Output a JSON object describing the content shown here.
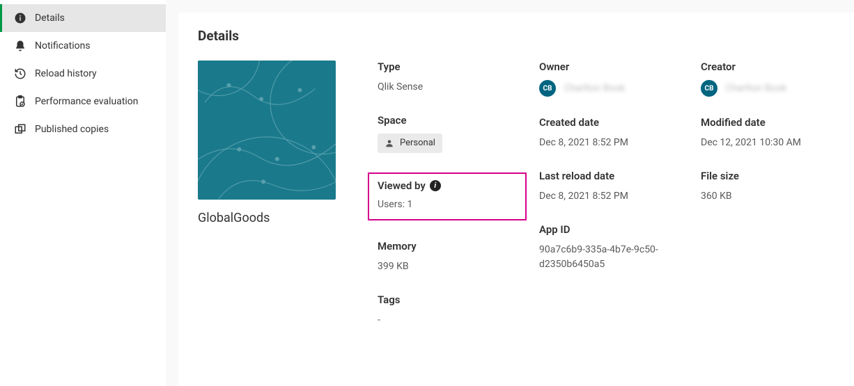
{
  "sidebar": {
    "items": [
      {
        "label": "Details"
      },
      {
        "label": "Notifications"
      },
      {
        "label": "Reload history"
      },
      {
        "label": "Performance evaluation"
      },
      {
        "label": "Published copies"
      }
    ]
  },
  "page": {
    "title": "Details"
  },
  "app": {
    "name": "GlobalGoods"
  },
  "details": {
    "type": {
      "label": "Type",
      "value": "Qlik Sense"
    },
    "space": {
      "label": "Space",
      "value": "Personal"
    },
    "viewed_by": {
      "label": "Viewed by",
      "value": "Users: 1"
    },
    "memory": {
      "label": "Memory",
      "value": "399 KB"
    },
    "tags": {
      "label": "Tags",
      "value": "-"
    },
    "owner": {
      "label": "Owner",
      "initials": "CB",
      "name": "Charlton Book"
    },
    "created_date": {
      "label": "Created date",
      "value": "Dec 8, 2021 8:52 PM"
    },
    "last_reload_date": {
      "label": "Last reload date",
      "value": "Dec 8, 2021 8:52 PM"
    },
    "app_id": {
      "label": "App ID",
      "value": "90a7c6b9-335a-4b7e-9c50-d2350b6450a5"
    },
    "creator": {
      "label": "Creator",
      "initials": "CB",
      "name": "Charlton Book"
    },
    "modified_date": {
      "label": "Modified date",
      "value": "Dec 12, 2021 10:30 AM"
    },
    "file_size": {
      "label": "File size",
      "value": "360 KB"
    }
  }
}
